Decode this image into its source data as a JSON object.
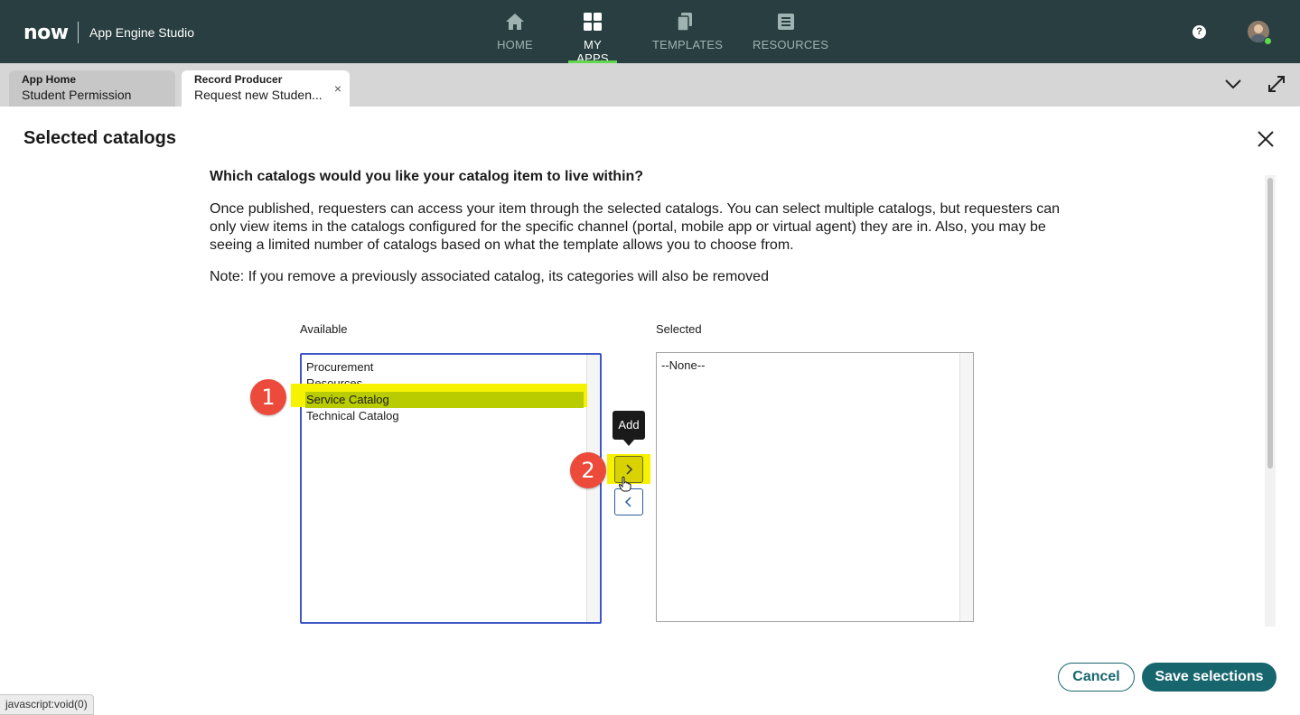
{
  "header": {
    "logo": "now",
    "app_name": "App Engine Studio",
    "nav": [
      {
        "label": "HOME",
        "icon": "home-icon",
        "active": false
      },
      {
        "label": "MY APPS",
        "icon": "grid-icon",
        "active": true
      },
      {
        "label": "TEMPLATES",
        "icon": "templates-icon",
        "active": false
      },
      {
        "label": "RESOURCES",
        "icon": "resources-icon",
        "active": false
      }
    ],
    "help": "?",
    "accent_color": "#62d84e",
    "bg_color": "#293e40"
  },
  "tabs": [
    {
      "type": "App Home",
      "title": "Student Permission"
    },
    {
      "type": "Record Producer",
      "title": "Request new Studen...",
      "close": "×"
    }
  ],
  "modal": {
    "title": "Selected catalogs",
    "question": "Which catalogs would you like your catalog item to live within?",
    "description": "Once published, requesters can access your item through the selected catalogs. You can select multiple catalogs, but requesters can only view items in the catalogs configured for the specific channel (portal, mobile app or virtual agent) they are in. Also, you may be seeing a limited number of catalogs based on what the template allows you to choose from.",
    "note": "Note: If you remove a previously associated catalog, its categories will also be removed",
    "available_label": "Available",
    "selected_label": "Selected",
    "available_items": [
      "Procurement",
      "Resources",
      "Service Catalog",
      "Technical Catalog"
    ],
    "available_selected_item": "Service Catalog",
    "selected_items": [
      "--None--"
    ],
    "tooltip": "Add",
    "steps": [
      "1",
      "2"
    ],
    "cancel_label": "Cancel",
    "save_label": "Save selections",
    "button_color": "#17666d",
    "highlight_color": "#f7f200"
  },
  "status_bar": "javascript:void(0)"
}
